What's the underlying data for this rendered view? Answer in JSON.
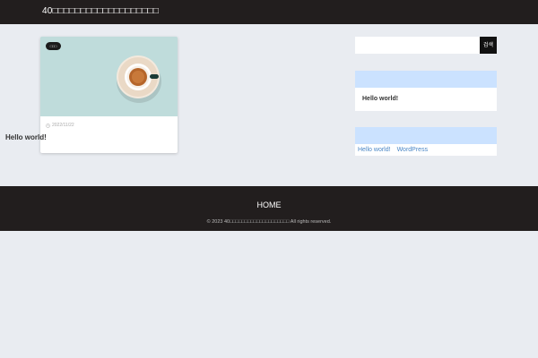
{
  "header": {
    "site_title": "40□□□□□□□□□□□□□□□□□□□"
  },
  "posts": [
    {
      "category": "□□□",
      "date": "2022/11/22",
      "title": "Hello world!",
      "image_icon": "coffee-cup-image"
    }
  ],
  "sidebar": {
    "search": {
      "placeholder": "",
      "button_label": "검색"
    },
    "recent_posts": {
      "heading": "",
      "items": [
        "Hello world!"
      ]
    },
    "tags": {
      "heading": "",
      "items": [
        "Hello world!",
        "WordPress"
      ]
    }
  },
  "footer": {
    "nav": [
      "HOME"
    ],
    "copyright": "© 2023 40□□□□□□□□□□□□□□□□□□□□ All rights reserved."
  },
  "colors": {
    "page_bg": "#e9ecf1",
    "header_bg": "#221e1e",
    "widget_head_bg": "#cbe2ff",
    "link": "#4a86c5"
  },
  "icons": {
    "date": "clock-icon",
    "search_button": "search-button-glyph"
  }
}
